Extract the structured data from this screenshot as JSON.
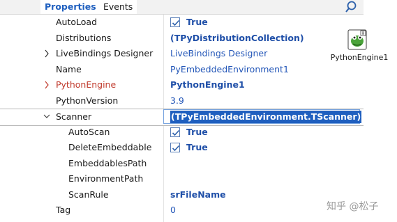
{
  "tabs": {
    "properties": "Properties",
    "events": "Events"
  },
  "rows": [
    {
      "name": "AutoLoad",
      "value": "True",
      "kind": "checkbox",
      "checked": true
    },
    {
      "name": "Distributions",
      "value": "(TPyDistributionCollection)",
      "kind": "bold"
    },
    {
      "name": "LiveBindings Designer",
      "value": "LiveBindings Designer",
      "kind": "link",
      "expander": "collapsed"
    },
    {
      "name": "Name",
      "value": "PyEmbeddedEnvironment1",
      "kind": "link"
    },
    {
      "name": "PythonEngine",
      "value": "PythonEngine1",
      "kind": "bold",
      "expander": "collapsed",
      "nameColor": "#c0392b"
    },
    {
      "name": "PythonVersion",
      "value": "3.9",
      "kind": "link"
    },
    {
      "name": "Scanner",
      "value": "(TPyEmbeddedEnvironment.TScanner)",
      "kind": "selected",
      "expander": "expanded"
    },
    {
      "name": "AutoScan",
      "value": "True",
      "kind": "checkbox",
      "checked": true,
      "indent": true
    },
    {
      "name": "DeleteEmbeddable",
      "value": "True",
      "kind": "checkbox",
      "checked": true,
      "indent": true
    },
    {
      "name": "EmbeddablesPath",
      "value": "",
      "kind": "link",
      "indent": true
    },
    {
      "name": "EnvironmentPath",
      "value": "",
      "kind": "link",
      "indent": true
    },
    {
      "name": "ScanRule",
      "value": "srFileName",
      "kind": "bold",
      "indent": true
    },
    {
      "name": "Tag",
      "value": "0",
      "kind": "link"
    }
  ],
  "component": {
    "label": "PythonEngine1",
    "icon": "python-engine-icon"
  },
  "watermark": "知乎 @松子",
  "colors": {
    "accent": "#1f5fbf",
    "value_blue": "#1f4fa8",
    "highlight_red": "#c0392b"
  }
}
